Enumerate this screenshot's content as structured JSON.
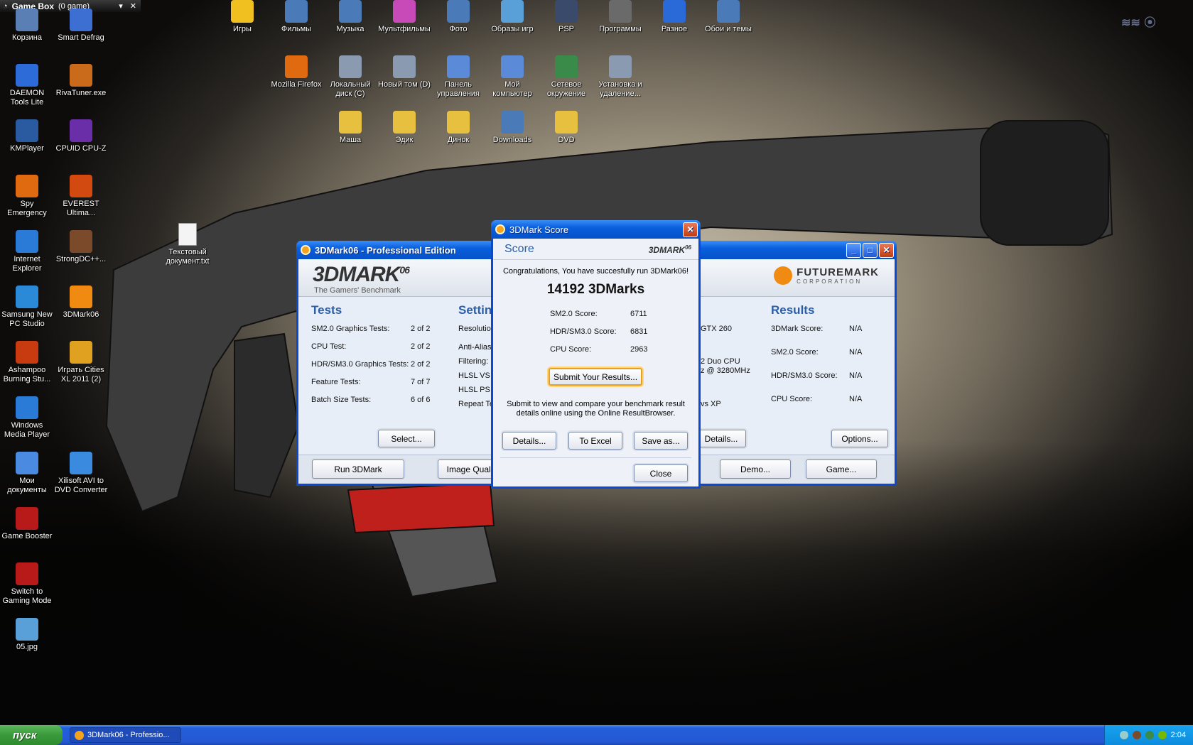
{
  "gamebox": {
    "title": "Game Box",
    "count": "(0 game)"
  },
  "desktop_left": [
    {
      "label": "Корзина",
      "icon": "recycle-bin-icon",
      "color": "#5a7fb5"
    },
    {
      "label": "Smart Defrag",
      "icon": "defrag-icon",
      "color": "#3c6fd1"
    },
    {
      "label": "DAEMON Tools Lite",
      "icon": "daemon-tools-icon",
      "color": "#2d6cd8"
    },
    {
      "label": "RivaTuner.exe",
      "icon": "rivatuner-icon",
      "color": "#c96b1a"
    },
    {
      "label": "KMPlayer",
      "icon": "kmplayer-icon",
      "color": "#2a5aa0"
    },
    {
      "label": "CPUID CPU-Z",
      "icon": "cpuz-icon",
      "color": "#6a2fa8"
    },
    {
      "label": "Spy Emergency",
      "icon": "spy-emergency-icon",
      "color": "#e06a10"
    },
    {
      "label": "EVEREST Ultima...",
      "icon": "everest-icon",
      "color": "#d24a10"
    },
    {
      "label": "Internet Explorer",
      "icon": "ie-icon",
      "color": "#2a7ad8"
    },
    {
      "label": "StrongDC++...",
      "icon": "strongdc-icon",
      "color": "#7a4a2a"
    },
    {
      "label": "Samsung New PC Studio",
      "icon": "samsung-pc-studio-icon",
      "color": "#2a8ad8"
    },
    {
      "label": "3DMark06",
      "icon": "3dmark-icon",
      "color": "#f08a10"
    },
    {
      "label": "Ashampoo Burning Stu...",
      "icon": "ashampoo-icon",
      "color": "#c83a10"
    },
    {
      "label": "Играть Cities XL 2011 (2)",
      "icon": "cities-xl-icon",
      "color": "#e0a020"
    },
    {
      "label": "Windows Media Player",
      "icon": "media-player-icon",
      "color": "#2a7ad8"
    },
    {
      "label": "Мои документы",
      "icon": "my-documents-icon",
      "color": "#4a8ae0"
    },
    {
      "label": "Xilisoft AVI to DVD Converter",
      "icon": "xilisoft-icon",
      "color": "#3a8ae0"
    },
    {
      "label": "Game Booster",
      "icon": "game-booster-icon",
      "color": "#b81a1a"
    },
    {
      "label": "Switch to Gaming Mode",
      "icon": "gaming-mode-icon",
      "color": "#b81a1a"
    },
    {
      "label": "05.jpg",
      "icon": "image-file-icon",
      "color": "#5aa0d8"
    }
  ],
  "text_doc": {
    "label": "Текстовый документ.txt",
    "icon": "text-file-icon"
  },
  "desktop_top": [
    {
      "label": "Игры",
      "icon": "star-icon",
      "color": "#f0c020"
    },
    {
      "label": "Фильмы",
      "icon": "films-icon",
      "color": "#4a7ab8"
    },
    {
      "label": "Музыка",
      "icon": "music-icon",
      "color": "#4a7ab8"
    },
    {
      "label": "Мультфильмы",
      "icon": "cartoons-icon",
      "color": "#c84ab8"
    },
    {
      "label": "Фото",
      "icon": "photo-icon",
      "color": "#4a7ab8"
    },
    {
      "label": "Образы игр",
      "icon": "disc-images-icon",
      "color": "#5aa0d8"
    },
    {
      "label": "PSP",
      "icon": "psp-icon",
      "color": "#3a4a6a"
    },
    {
      "label": "Программы",
      "icon": "programs-icon",
      "color": "#6a6a6a"
    },
    {
      "label": "Разное",
      "icon": "help-icon",
      "color": "#2a6ad8"
    },
    {
      "label": "Обои и темы",
      "icon": "wallpapers-icon",
      "color": "#4a7ab8"
    },
    {
      "label": "Mozilla Firefox",
      "icon": "firefox-icon",
      "color": "#e06a10"
    },
    {
      "label": "Локальный диск (C)",
      "icon": "local-disk-icon",
      "color": "#8a9ab0"
    },
    {
      "label": "Новый том (D)",
      "icon": "new-volume-icon",
      "color": "#8a9ab0"
    },
    {
      "label": "Панель управления",
      "icon": "control-panel-icon",
      "color": "#5a8ad8"
    },
    {
      "label": "Мой компьютер",
      "icon": "my-computer-icon",
      "color": "#5a8ad8"
    },
    {
      "label": "Сетевое окружение",
      "icon": "network-icon",
      "color": "#3a8a4a"
    },
    {
      "label": "Установка и удаление...",
      "icon": "add-remove-icon",
      "color": "#8a9ab0"
    },
    {
      "label": "Маша",
      "icon": "folder-icon",
      "color": "#e8c040"
    },
    {
      "label": "Эдик",
      "icon": "folder-icon",
      "color": "#e8c040"
    },
    {
      "label": "Динок",
      "icon": "folder-icon",
      "color": "#e8c040"
    },
    {
      "label": "Downloads",
      "icon": "downloads-icon",
      "color": "#4a7ab8"
    },
    {
      "label": "DVD",
      "icon": "folder-icon",
      "color": "#e8c040"
    }
  ],
  "main": {
    "title": "3DMark06 - Professional Edition",
    "logo": "3DMARK",
    "logo_sup": "06",
    "tagline": "The Gamers' Benchmark",
    "futuremark": "FUTUREMARK",
    "futuremark_sub": "CORPORATION",
    "tests_title": "Tests",
    "tests": [
      {
        "label": "SM2.0 Graphics Tests:",
        "value": "2 of 2"
      },
      {
        "label": "CPU Test:",
        "value": "2 of 2"
      },
      {
        "label": "HDR/SM3.0 Graphics Tests:",
        "value": "2 of 2"
      },
      {
        "label": "Feature Tests:",
        "value": "7 of 7"
      },
      {
        "label": "Batch Size Tests:",
        "value": "6 of 6"
      }
    ],
    "select_btn": "Select...",
    "settings_title": "Settin",
    "settings": [
      "Resolution",
      "Anti-Aliasi",
      "Filtering:",
      "HLSL VS T",
      "HLSL PS T",
      "Repeat Te"
    ],
    "system_frag": [
      "GTX 260",
      "2 Duo CPU",
      "z @ 3280MHz",
      "vs XP"
    ],
    "details_btn": "Details...",
    "results_title": "Results",
    "results": [
      {
        "label": "3DMark Score:",
        "value": "N/A"
      },
      {
        "label": "SM2.0 Score:",
        "value": "N/A"
      },
      {
        "label": "HDR/SM3.0 Score:",
        "value": "N/A"
      },
      {
        "label": "CPU Score:",
        "value": "N/A"
      }
    ],
    "options_btn": "Options...",
    "run_btn": "Run 3DMark",
    "image_quality_btn": "Image Quali",
    "demo_btn": "Demo...",
    "game_btn": "Game..."
  },
  "score": {
    "title": "3DMark Score",
    "heading": "Score",
    "logo": "3DMARK",
    "logo_sup": "06",
    "congrats": "Congratulations, You have succesfully run 3DMark06!",
    "total": "14192 3DMarks",
    "rows": [
      {
        "label": "SM2.0 Score:",
        "value": "6711"
      },
      {
        "label": "HDR/SM3.0 Score:",
        "value": "6831"
      },
      {
        "label": "CPU Score:",
        "value": "2963"
      }
    ],
    "submit_btn": "Submit Your Results...",
    "submit_text": "Submit to view and compare your benchmark result details online using the Online ResultBrowser.",
    "details_btn": "Details...",
    "excel_btn": "To Excel",
    "saveas_btn": "Save as...",
    "close_btn": "Close"
  },
  "taskbar": {
    "start": "пуск",
    "task": "3DMark06 - Professio...",
    "clock": "2:04"
  }
}
